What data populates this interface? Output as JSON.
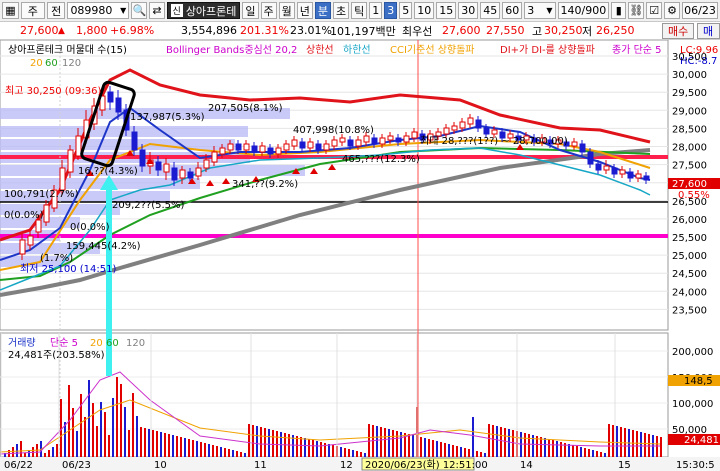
{
  "toolbar": {
    "kind": "주",
    "mode": "전",
    "code": "089980",
    "name_tag": "신",
    "name": "상아프론테",
    "periods": [
      "일",
      "주",
      "월",
      "년",
      "분",
      "초",
      "틱"
    ],
    "period_selected": "분",
    "minutes": [
      "1",
      "3",
      "5",
      "10",
      "15",
      "30",
      "45",
      "60"
    ],
    "minute_selected": "3",
    "count_select": "3",
    "paging": "140/900",
    "date": "06/23"
  },
  "price_row": {
    "price": "27,600",
    "change": "1,800",
    "change_pct": "+6.98%",
    "volume": "3,554,896",
    "vol_ratio": "201.31%",
    "turnover": "23.01%",
    "amount": "101,197백만",
    "best_ask_label": "최우선",
    "best_ask": "27,600",
    "best_bid": "27,550",
    "high_label": "고",
    "high": "30,250",
    "low_label": "저",
    "low": "26,250",
    "buy_button": "매수",
    "sell_button": "매"
  },
  "legend": {
    "name": "상아프론테크 머물대 수(15)",
    "bollinger": "Bollinger Bands중심선 20,2",
    "upper": "상한선",
    "lower": "하한선",
    "cci": "CCI기준선 상향돌파",
    "di": "DI+가 DI-를 상향돌파",
    "close": "종가 단순 5",
    "ma_periods": [
      "20",
      "60",
      "120"
    ],
    "right_top": "LC:9.96",
    "right_bottom": "HC:-8.7"
  },
  "annotations": {
    "high_marker": "최고 30,250 (09:36)",
    "low_marker": "최저 25,100 (14:51)",
    "price_tag": "27,600",
    "pct_tag": "0.55%",
    "vp_labels": [
      {
        "text": "207,505(8.1%)"
      },
      {
        "text": "137,987(5.3%)"
      },
      {
        "text": "407,998(10.8%)"
      },
      {
        "text": "16,??(4.3%)"
      },
      {
        "text": "465,???(12.3%)"
      },
      {
        "text": "341,??(9.2%)"
      },
      {
        "text": "100,791(2.7%)"
      },
      {
        "text": "209,2??(5.5%)"
      },
      {
        "text": "0(0.0%)"
      },
      {
        "text": "0(0.0%)"
      },
      {
        "text": "159,445(4.2%)"
      },
      {
        "text": "(1.7%)"
      }
    ],
    "mid_label": "최대 28,???(1??)  ~  28,700.00)"
  },
  "volume_panel": {
    "legend_name": "거래량",
    "legend_ma": "단순 5",
    "ma_periods": [
      "20",
      "60",
      "120"
    ],
    "current": "24,481주(203.58%)",
    "right_tag_top": "148,5",
    "right_tag_bottom": "24,481"
  },
  "y_axis_price": [
    "30,500",
    "30,000",
    "29,500",
    "29,000",
    "28,500",
    "28,000",
    "27,500",
    "27,000",
    "26,500",
    "26,000",
    "25,500",
    "25,000",
    "24,500",
    "24,000",
    "23,500"
  ],
  "y_axis_volume": [
    "200,000",
    "150,000",
    "100,000",
    "50,000"
  ],
  "x_axis": {
    "labels": [
      "06/22",
      "06/23",
      "10",
      "11",
      "12",
      "13",
      "14",
      "15"
    ],
    "cursor_label": "2020/06/23(화) 12:51:00",
    "right_time": "15:30:5"
  },
  "colors": {
    "upper_band": "#e0131a",
    "middle_band": "#1e36c8",
    "lower_band": "#17a7c6",
    "ma20": "#f0a202",
    "ma60": "#20a020",
    "ma120": "#808080",
    "hline_red": "#ff1f4d",
    "hline_magenta": "#ff00cc",
    "volume_profile": "#b8b8f5",
    "up_candle": "#e00000",
    "down_candle": "#1a1ad0",
    "cyan_arrow": "#3ff0f0"
  }
}
